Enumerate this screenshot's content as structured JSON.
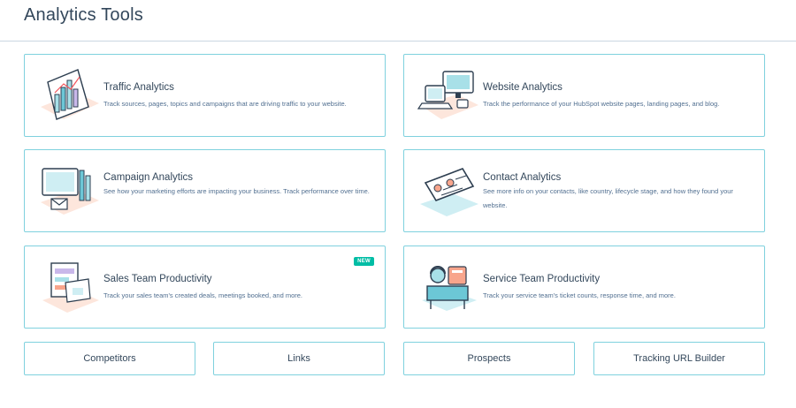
{
  "page": {
    "title": "Analytics Tools"
  },
  "cards": [
    {
      "title": "Traffic Analytics",
      "desc": "Track sources, pages, topics and campaigns that are driving traffic to your website."
    },
    {
      "title": "Website Analytics",
      "desc": "Track the performance of your HubSpot website pages, landing pages, and blog."
    },
    {
      "title": "Campaign Analytics",
      "desc": "See how your marketing efforts are impacting your business. Track performance over time."
    },
    {
      "title": "Contact Analytics",
      "desc": "See more info on your contacts, like country, lifecycle stage, and how they found your website."
    },
    {
      "title": "Sales Team Productivity",
      "desc": "Track your sales team's created deals, meetings booked, and more.",
      "badge": "NEW"
    },
    {
      "title": "Service Team Productivity",
      "desc": "Track your service team's ticket counts, response time, and more."
    }
  ],
  "links": [
    "Competitors",
    "Links",
    "Prospects",
    "Tracking URL Builder"
  ],
  "colors": {
    "accent_border": "#7fd1de",
    "badge": "#00bda5",
    "text": "#33475b"
  }
}
